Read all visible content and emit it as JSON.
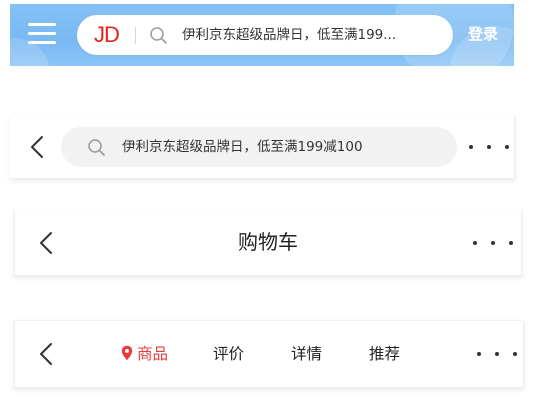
{
  "colors": {
    "header_blue": "#7ab8f3",
    "jd_red": "#e1251b",
    "active_tab_red": "#e93b3d",
    "text_dark": "#222222",
    "search_bg": "#f2f2f2"
  },
  "home_header": {
    "menu_icon": "hamburger-menu-icon",
    "logo": "JD",
    "search_icon": "search-icon",
    "search_placeholder": "伊利京东超级品牌日，低至满199...",
    "login_label": "登录"
  },
  "search_header": {
    "back_icon": "chevron-left-icon",
    "search_icon": "search-icon",
    "search_placeholder": "伊利京东超级品牌日，低至满199减100",
    "more_icon": "more-dots-icon"
  },
  "cart_header": {
    "back_icon": "chevron-left-icon",
    "title": "购物车",
    "more_icon": "more-dots-icon"
  },
  "product_header": {
    "back_icon": "chevron-left-icon",
    "more_icon": "more-dots-icon",
    "tabs": [
      {
        "label": "商品",
        "active": true,
        "icon": "location-pin-icon"
      },
      {
        "label": "评价",
        "active": false
      },
      {
        "label": "详情",
        "active": false
      },
      {
        "label": "推荐",
        "active": false
      }
    ]
  }
}
